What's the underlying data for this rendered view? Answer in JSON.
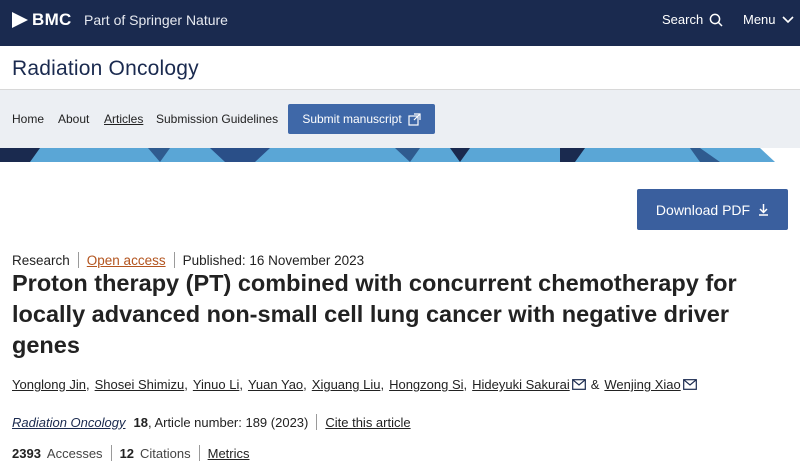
{
  "header": {
    "logo_text": "BMC",
    "part_of": "Part of Springer Nature",
    "search_label": "Search",
    "search_icon": "search-icon",
    "menu_label": "Menu",
    "menu_icon": "chevron-down-icon"
  },
  "journal": {
    "title": "Radiation Oncology"
  },
  "nav": {
    "items": [
      {
        "label": "Home"
      },
      {
        "label": "About"
      },
      {
        "label": "Articles",
        "active": true
      },
      {
        "label": "Submission Guidelines"
      }
    ],
    "submit_label": "Submit manuscript",
    "submit_icon": "external-link-icon"
  },
  "download": {
    "label": "Download PDF",
    "icon": "download-icon"
  },
  "article": {
    "type": "Research",
    "access": "Open access",
    "published": "Published: 16 November 2023",
    "title": "Proton therapy (PT) combined with concurrent chemotherapy for locally advanced non-small cell lung cancer with negative driver genes",
    "authors": [
      {
        "name": "Yonglong Jin"
      },
      {
        "name": "Shosei Shimizu"
      },
      {
        "name": "Yinuo Li"
      },
      {
        "name": "Yuan Yao"
      },
      {
        "name": "Xiguang Liu"
      },
      {
        "name": "Hongzong Si"
      },
      {
        "name": "Hideyuki Sakurai",
        "mail": true
      },
      {
        "name": "Wenjing Xiao",
        "mail": true
      }
    ],
    "ampersand": "&",
    "journal_name": "Radiation Oncology",
    "volume": "18",
    "article_number": ", Article number: 189 (2023)",
    "cite_label": "Cite this article",
    "accesses_count": "2393",
    "accesses_label": "Accesses",
    "citations_count": "12",
    "citations_label": "Citations",
    "metrics_label": "Metrics"
  },
  "colors": {
    "header_bg": "#1a2a4f",
    "nav_bg": "#eceff3",
    "button_blue": "#3f68a8",
    "open_access": "#b3541e",
    "band_light": "#5aa6d6",
    "band_dark": "#1a2a4f"
  }
}
